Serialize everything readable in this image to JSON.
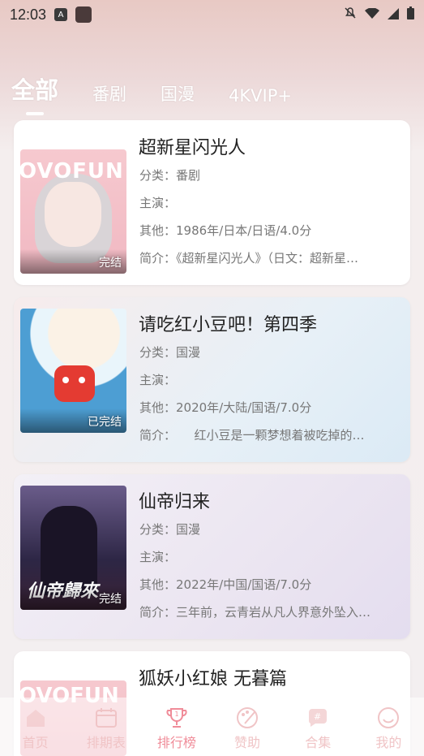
{
  "status_bar": {
    "time": "12:03"
  },
  "tabs": [
    {
      "label": "全部",
      "active": true
    },
    {
      "label": "番剧",
      "active": false
    },
    {
      "label": "国漫",
      "active": false
    },
    {
      "label": "4KVIP+",
      "active": false
    }
  ],
  "cards": [
    {
      "title": "超新星闪光人",
      "category": "分类：番剧",
      "cast": "主演：",
      "other": "其他：1986年/日本/日语/4.0分",
      "summary": "简介：《超新星闪光人》（日文：超新星…",
      "badge": "完结",
      "cover_text": "OVOFUN"
    },
    {
      "title": "请吃红小豆吧！第四季",
      "category": "分类：国漫",
      "cast": "主演：",
      "other": "其他：2020年/大陆/国语/7.0分",
      "summary": "简介：　　红小豆是一颗梦想着被吃掉的…",
      "badge": "已完结"
    },
    {
      "title": "仙帝归来",
      "category": "分类：国漫",
      "cast": "主演：",
      "other": "其他：2022年/中国/国语/7.0分",
      "summary": "简介：三年前，云青岩从凡人界意外坠入…",
      "badge": "完结",
      "cover_text": "仙帝歸來"
    },
    {
      "title": "狐妖小红娘 无暮篇",
      "cover_text": "OVOFUN"
    }
  ],
  "tab_bar": [
    {
      "label": "首页",
      "icon": "home-icon",
      "active": false
    },
    {
      "label": "排期表",
      "icon": "calendar-icon",
      "active": false
    },
    {
      "label": "排行榜",
      "icon": "trophy-icon",
      "active": true
    },
    {
      "label": "赞助",
      "icon": "palette-icon",
      "active": false
    },
    {
      "label": "合集",
      "icon": "hashtag-chat-icon",
      "active": false
    },
    {
      "label": "我的",
      "icon": "smile-icon",
      "active": false
    }
  ],
  "colors": {
    "accent": "#f08c99",
    "inactive_tab_bar": "#f0c4c6"
  }
}
